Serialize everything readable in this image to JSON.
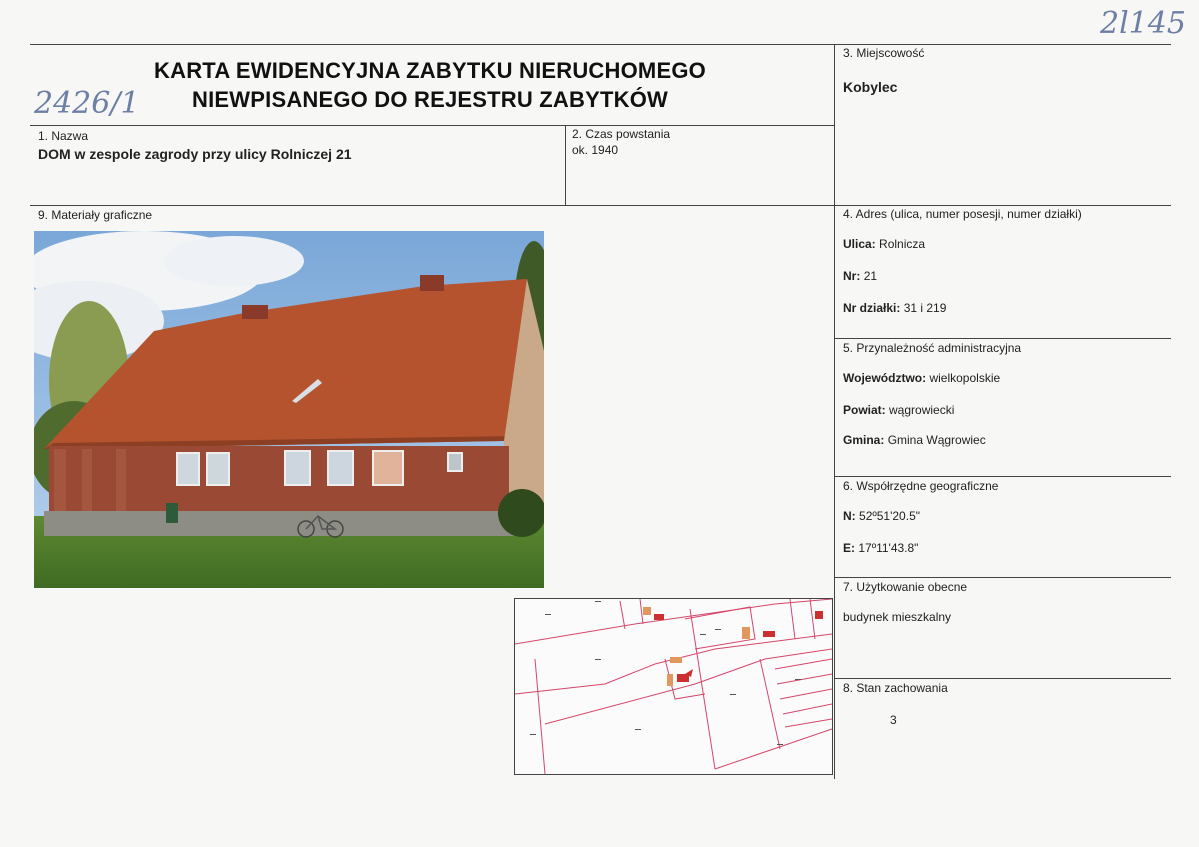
{
  "handwritten": {
    "top_right": "2l145",
    "left": "2426/1"
  },
  "header": {
    "title_line1": "KARTA EWIDENCYJNA ZABYTKU NIERUCHOMEGO",
    "title_line2": "NIEWPISANEGO DO REJESTRU ZABYTKÓW"
  },
  "fields": {
    "nazwa": {
      "label": "1. Nazwa",
      "value": "DOM w zespole zagrody przy ulicy Rolniczej 21"
    },
    "czas": {
      "label": "2. Czas powstania",
      "value": "ok. 1940"
    },
    "miejscowosc": {
      "label": "3. Miejscowość",
      "value": "Kobylec"
    },
    "adres": {
      "label": "4. Adres (ulica, numer posesji, numer działki)",
      "ulica_key": "Ulica:",
      "ulica_val": "Rolnicza",
      "nr_key": "Nr:",
      "nr_val": "21",
      "dzialki_key": "Nr działki:",
      "dzialki_val": "31 i 219"
    },
    "przynaleznosc": {
      "label": "5. Przynależność administracyjna",
      "woj_key": "Województwo:",
      "woj_val": "wielkopolskie",
      "powiat_key": "Powiat:",
      "powiat_val": "wągrowiecki",
      "gmina_key": "Gmina:",
      "gmina_val": "Gmina Wągrowiec"
    },
    "wspolrzedne": {
      "label": "6. Współrzędne geograficzne",
      "n_key": "N:",
      "n_val": "52º51'20.5\"",
      "e_key": "E:",
      "e_val": "17º11'43.8\""
    },
    "uzytkowanie": {
      "label": "7. Użytkowanie obecne",
      "value": "budynek mieszkalny"
    },
    "stan": {
      "label": "8. Stan zachowania",
      "value": "3"
    },
    "materialy": {
      "label": "9. Materiały graficzne"
    }
  },
  "colors": {
    "roof": "#b5532f",
    "brick": "#9a4a34",
    "sky": "#8fb6df",
    "grass": "#4d7a2a",
    "map_line": "#d4466a",
    "map_building": "#cc2f2f",
    "map_building_alt": "#e0985f"
  }
}
